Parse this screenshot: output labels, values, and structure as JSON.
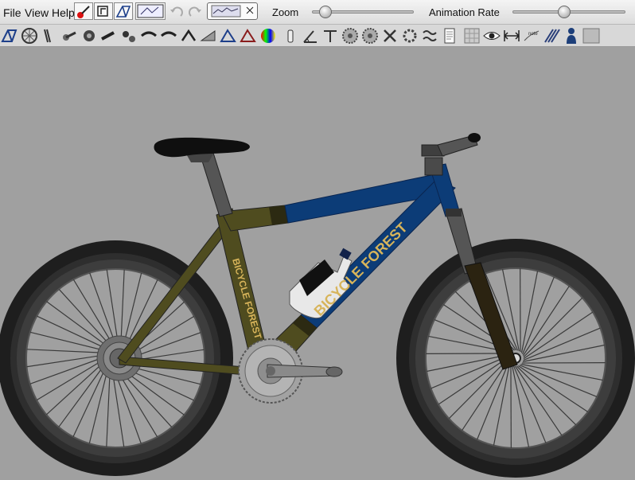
{
  "menus": [
    {
      "label": "File"
    },
    {
      "label": "View"
    },
    {
      "label": "Help"
    }
  ],
  "controls": {
    "zoom_label": "Zoom",
    "zoom_value": 0.08,
    "animation_rate_label": "Animation Rate",
    "animation_rate_value": 0.45
  },
  "toolbar_icons": [
    "frame-icon",
    "wheel-icon",
    "fork-icon",
    "crank-icon",
    "headset-icon",
    "stem-icon",
    "derailleur-icon",
    "handlebar-icon",
    "handlebar-icon",
    "brake-icon",
    "frame-shape-icon",
    "frame-tubes-icon",
    "frame-outline-icon",
    "color-wheel-icon",
    "bottle-icon",
    "angle-icon",
    "measure-icon",
    "chainring-icon",
    "chainring-icon",
    "tools-icon",
    "gear-icon",
    "spring-icon",
    "document-icon",
    "grid-icon",
    "eye-icon",
    "dimension-icon",
    "note-icon",
    "stripes-icon",
    "rider-icon",
    "background-icon"
  ],
  "bike": {
    "brand_top": "BICYCLE FOREST",
    "brand_seat": "BICYCLE FOREST",
    "colors": {
      "frame_olive": "#4f4c1f",
      "frame_blue": "#0c3c77",
      "lettering": "#d7b45a",
      "tire": "#1f1f1f",
      "rim": "#3a3a3a"
    }
  }
}
